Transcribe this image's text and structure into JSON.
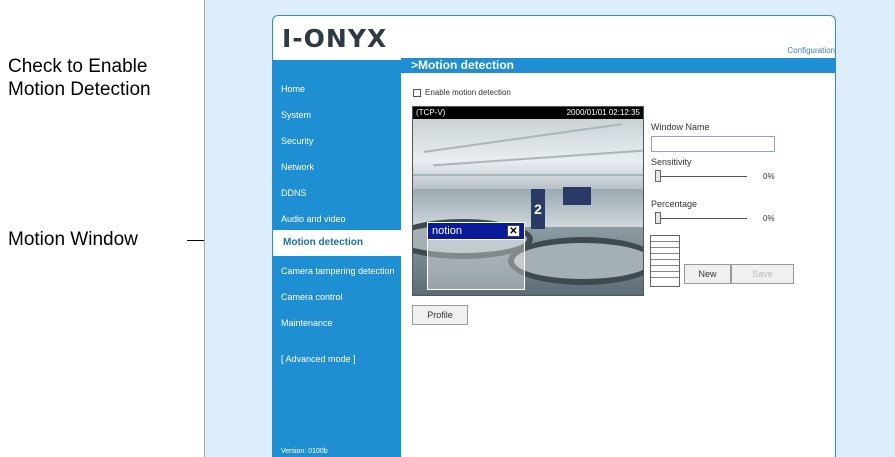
{
  "annotations": {
    "enable_callout_line1": "Check to Enable",
    "enable_callout_line2": "Motion Detection",
    "window_callout": "Motion Window"
  },
  "header": {
    "logo": "I-ONYX",
    "config_link": "Configuration"
  },
  "sidebar": {
    "items": [
      {
        "label": "Home"
      },
      {
        "label": "System"
      },
      {
        "label": "Security"
      },
      {
        "label": "Network"
      },
      {
        "label": "DDNS"
      },
      {
        "label": "Audio and video"
      },
      {
        "label": "Motion detection",
        "active": true
      },
      {
        "label": "Camera tampering detection"
      },
      {
        "label": "Camera control"
      },
      {
        "label": "Maintenance"
      },
      {
        "label": "[ Advanced mode ]"
      }
    ],
    "version": "Version: 0100b"
  },
  "main": {
    "title": ">Motion detection",
    "enable_label": "Enable motion detection",
    "enable_checked": false,
    "video": {
      "stream_label": "(TCP-V)",
      "timestamp": "2000/01/01 02:12:35",
      "overlay_number": "2"
    },
    "motion_window": {
      "label": "notion",
      "close": "✕"
    },
    "window_name_label": "Window Name",
    "window_name_value": "",
    "sensitivity_label": "Sensitivity",
    "sensitivity_value": "0%",
    "percentage_label": "Percentage",
    "percentage_value": "0%",
    "new_button": "New",
    "save_button": "Save",
    "profile_button": "Profile"
  },
  "colors": {
    "accent": "#1e8fd2",
    "background": "#ddeefa",
    "motion_window": "#0a1a9c"
  }
}
